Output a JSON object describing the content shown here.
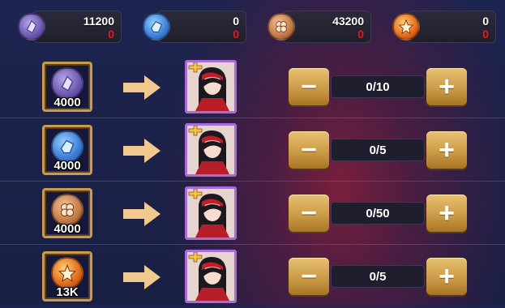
{
  "currencies": [
    {
      "name": "purple-crystal-token",
      "amount": "11200",
      "used": "0",
      "icon": "crystal-icon",
      "color": "#6c58b0"
    },
    {
      "name": "blue-crystal-token",
      "amount": "0",
      "used": "0",
      "icon": "crystal-icon",
      "color": "#3d7fd8"
    },
    {
      "name": "bronze-clover-token",
      "amount": "43200",
      "used": "0",
      "icon": "clover-icon",
      "color": "#c27a47"
    },
    {
      "name": "orange-star-token",
      "amount": "0",
      "used": "0",
      "icon": "star-icon",
      "color": "#e06a1e"
    }
  ],
  "rows": [
    {
      "cost": "4000",
      "coin": "purple",
      "count": "0/10"
    },
    {
      "cost": "4000",
      "coin": "blue",
      "count": "0/5"
    },
    {
      "cost": "4000",
      "coin": "bronze",
      "count": "0/50"
    },
    {
      "cost": "13K",
      "coin": "orange",
      "count": "0/5"
    }
  ],
  "buttons": {
    "minus": "−",
    "plus": "+"
  },
  "colors": {
    "accent_gold": "#c89a52",
    "used_red": "#e01b1b",
    "portrait_border": "#a86cd6"
  }
}
